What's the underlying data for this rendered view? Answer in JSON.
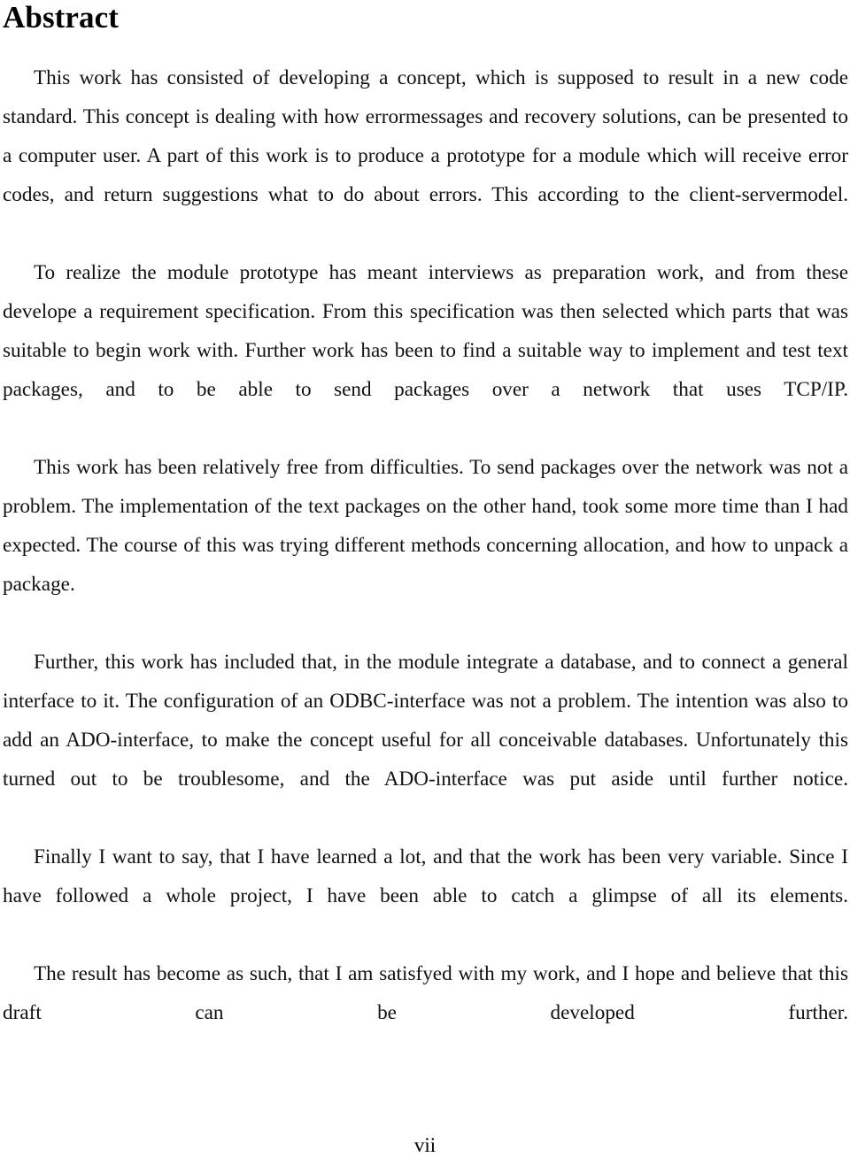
{
  "document": {
    "heading": "Abstract",
    "paragraphs": [
      "This work has consisted of developing a concept, which is supposed to result in a new code standard. This concept is dealing with how errormessages and recovery solutions, can be presented to a computer user. A part of this work is to produce a prototype for a module which will receive error codes, and return suggestions what to do about errors. This according to the client-servermodel.",
      "To realize the module prototype has meant interviews as preparation work, and from these develope a requirement specification. From this specification was then selected which parts that was suitable to begin work with. Further work has been to find a suitable way to implement and test text packages, and to be able to send packages over a network that uses TCP/IP.",
      "This work has been relatively free from difficulties. To send packages over the network was not a problem. The implementation of the text packages on the other hand, took some more time than I had expected. The course of this was trying different methods concerning allocation, and how to unpack a package.",
      "Further, this work has included that, in the module integrate a database, and to connect a general interface to it. The configuration of an ODBC-interface was not a problem. The intention was also to add an ADO-interface, to make the concept useful for all conceivable databases. Unfortunately this turned out to be troublesome, and the ADO-interface was put aside until further notice.",
      "Finally I want to say, that I have learned a lot, and that the work has been very variable. Since I have followed a whole project, I have been able to catch a glimpse of all its elements.",
      "The result has become as such, that I am satisfyed with my work, and I hope and believe that this draft can be developed further."
    ],
    "page_number": "vii"
  }
}
